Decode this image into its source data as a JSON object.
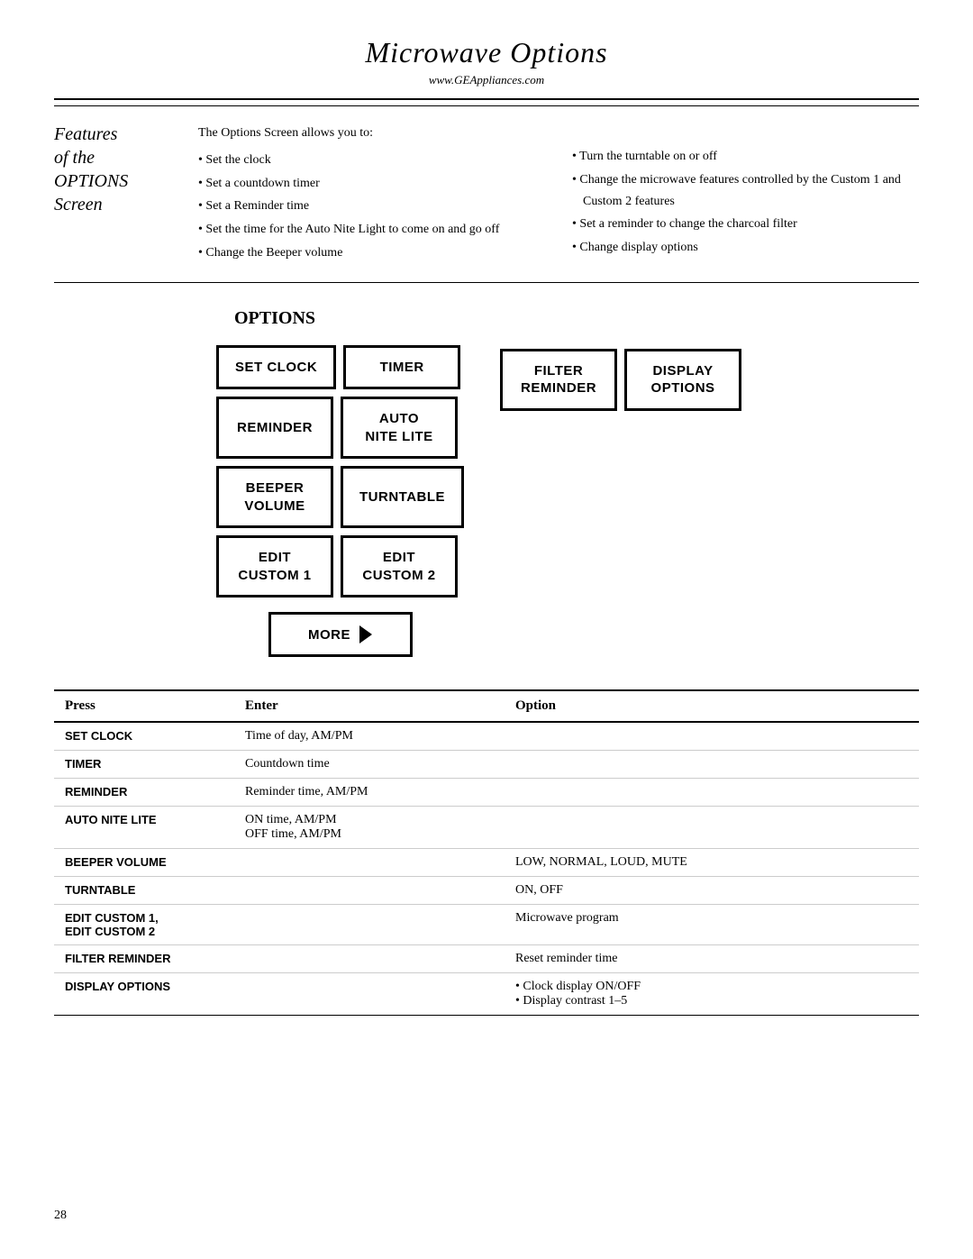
{
  "header": {
    "title": "Microwave Options",
    "url": "www.GEAppliances.com"
  },
  "features": {
    "label_line1": "Features",
    "label_line2": "of the",
    "label_line3": "OPTIONS",
    "label_line4": "Screen",
    "intro": "The Options Screen allows you to:",
    "left_items": [
      "Set the clock",
      "Set a countdown timer",
      "Set a Reminder time",
      "Set the time for the Auto Nite Light to come on and go off",
      "Change the Beeper volume"
    ],
    "right_items": [
      "Turn the turntable on or off",
      "Change the microwave features controlled by the Custom 1 and Custom 2 features",
      "Set a reminder to change the charcoal filter",
      "Change display options"
    ]
  },
  "options_heading": "OPTIONS",
  "buttons": {
    "set_clock": "SET CLOCK",
    "timer": "TIMER",
    "reminder": "REMINDER",
    "auto_nite_lite": "AUTO\nNITE LITE",
    "beeper_volume": "BEEPER\nVOLUME",
    "turntable": "TURNTABLE",
    "edit_custom1": "EDIT\nCUSTOM 1",
    "edit_custom2": "EDIT\nCUSTOM 2",
    "more": "MORE",
    "filter_reminder_line1": "FILTER",
    "filter_reminder_line2": "REMINDER",
    "display_options_line1": "DISPLAY",
    "display_options_line2": "OPTIONS"
  },
  "table": {
    "headers": {
      "press": "Press",
      "enter": "Enter",
      "option": "Option"
    },
    "rows": [
      {
        "press": "SET CLOCK",
        "enter": "Time of day, AM/PM",
        "option": ""
      },
      {
        "press": "TIMER",
        "enter": "Countdown time",
        "option": ""
      },
      {
        "press": "REMINDER",
        "enter": "Reminder time, AM/PM",
        "option": ""
      },
      {
        "press": "AUTO NITE LITE",
        "enter": "ON time, AM/PM\nOFF time, AM/PM",
        "option": ""
      },
      {
        "press": "BEEPER VOLUME",
        "enter": "",
        "option": "LOW, NORMAL, LOUD, MUTE"
      },
      {
        "press": "TURNTABLE",
        "enter": "",
        "option": "ON, OFF"
      },
      {
        "press": "EDIT CUSTOM 1,\nEDIT CUSTOM 2",
        "enter": "",
        "option": "Microwave program"
      },
      {
        "press": "FILTER REMINDER",
        "enter": "",
        "option": "Reset reminder time"
      },
      {
        "press": "DISPLAY OPTIONS",
        "enter": "",
        "option_items": [
          "Clock display ON/OFF",
          "Display contrast 1–5"
        ]
      }
    ]
  },
  "page_number": "28"
}
